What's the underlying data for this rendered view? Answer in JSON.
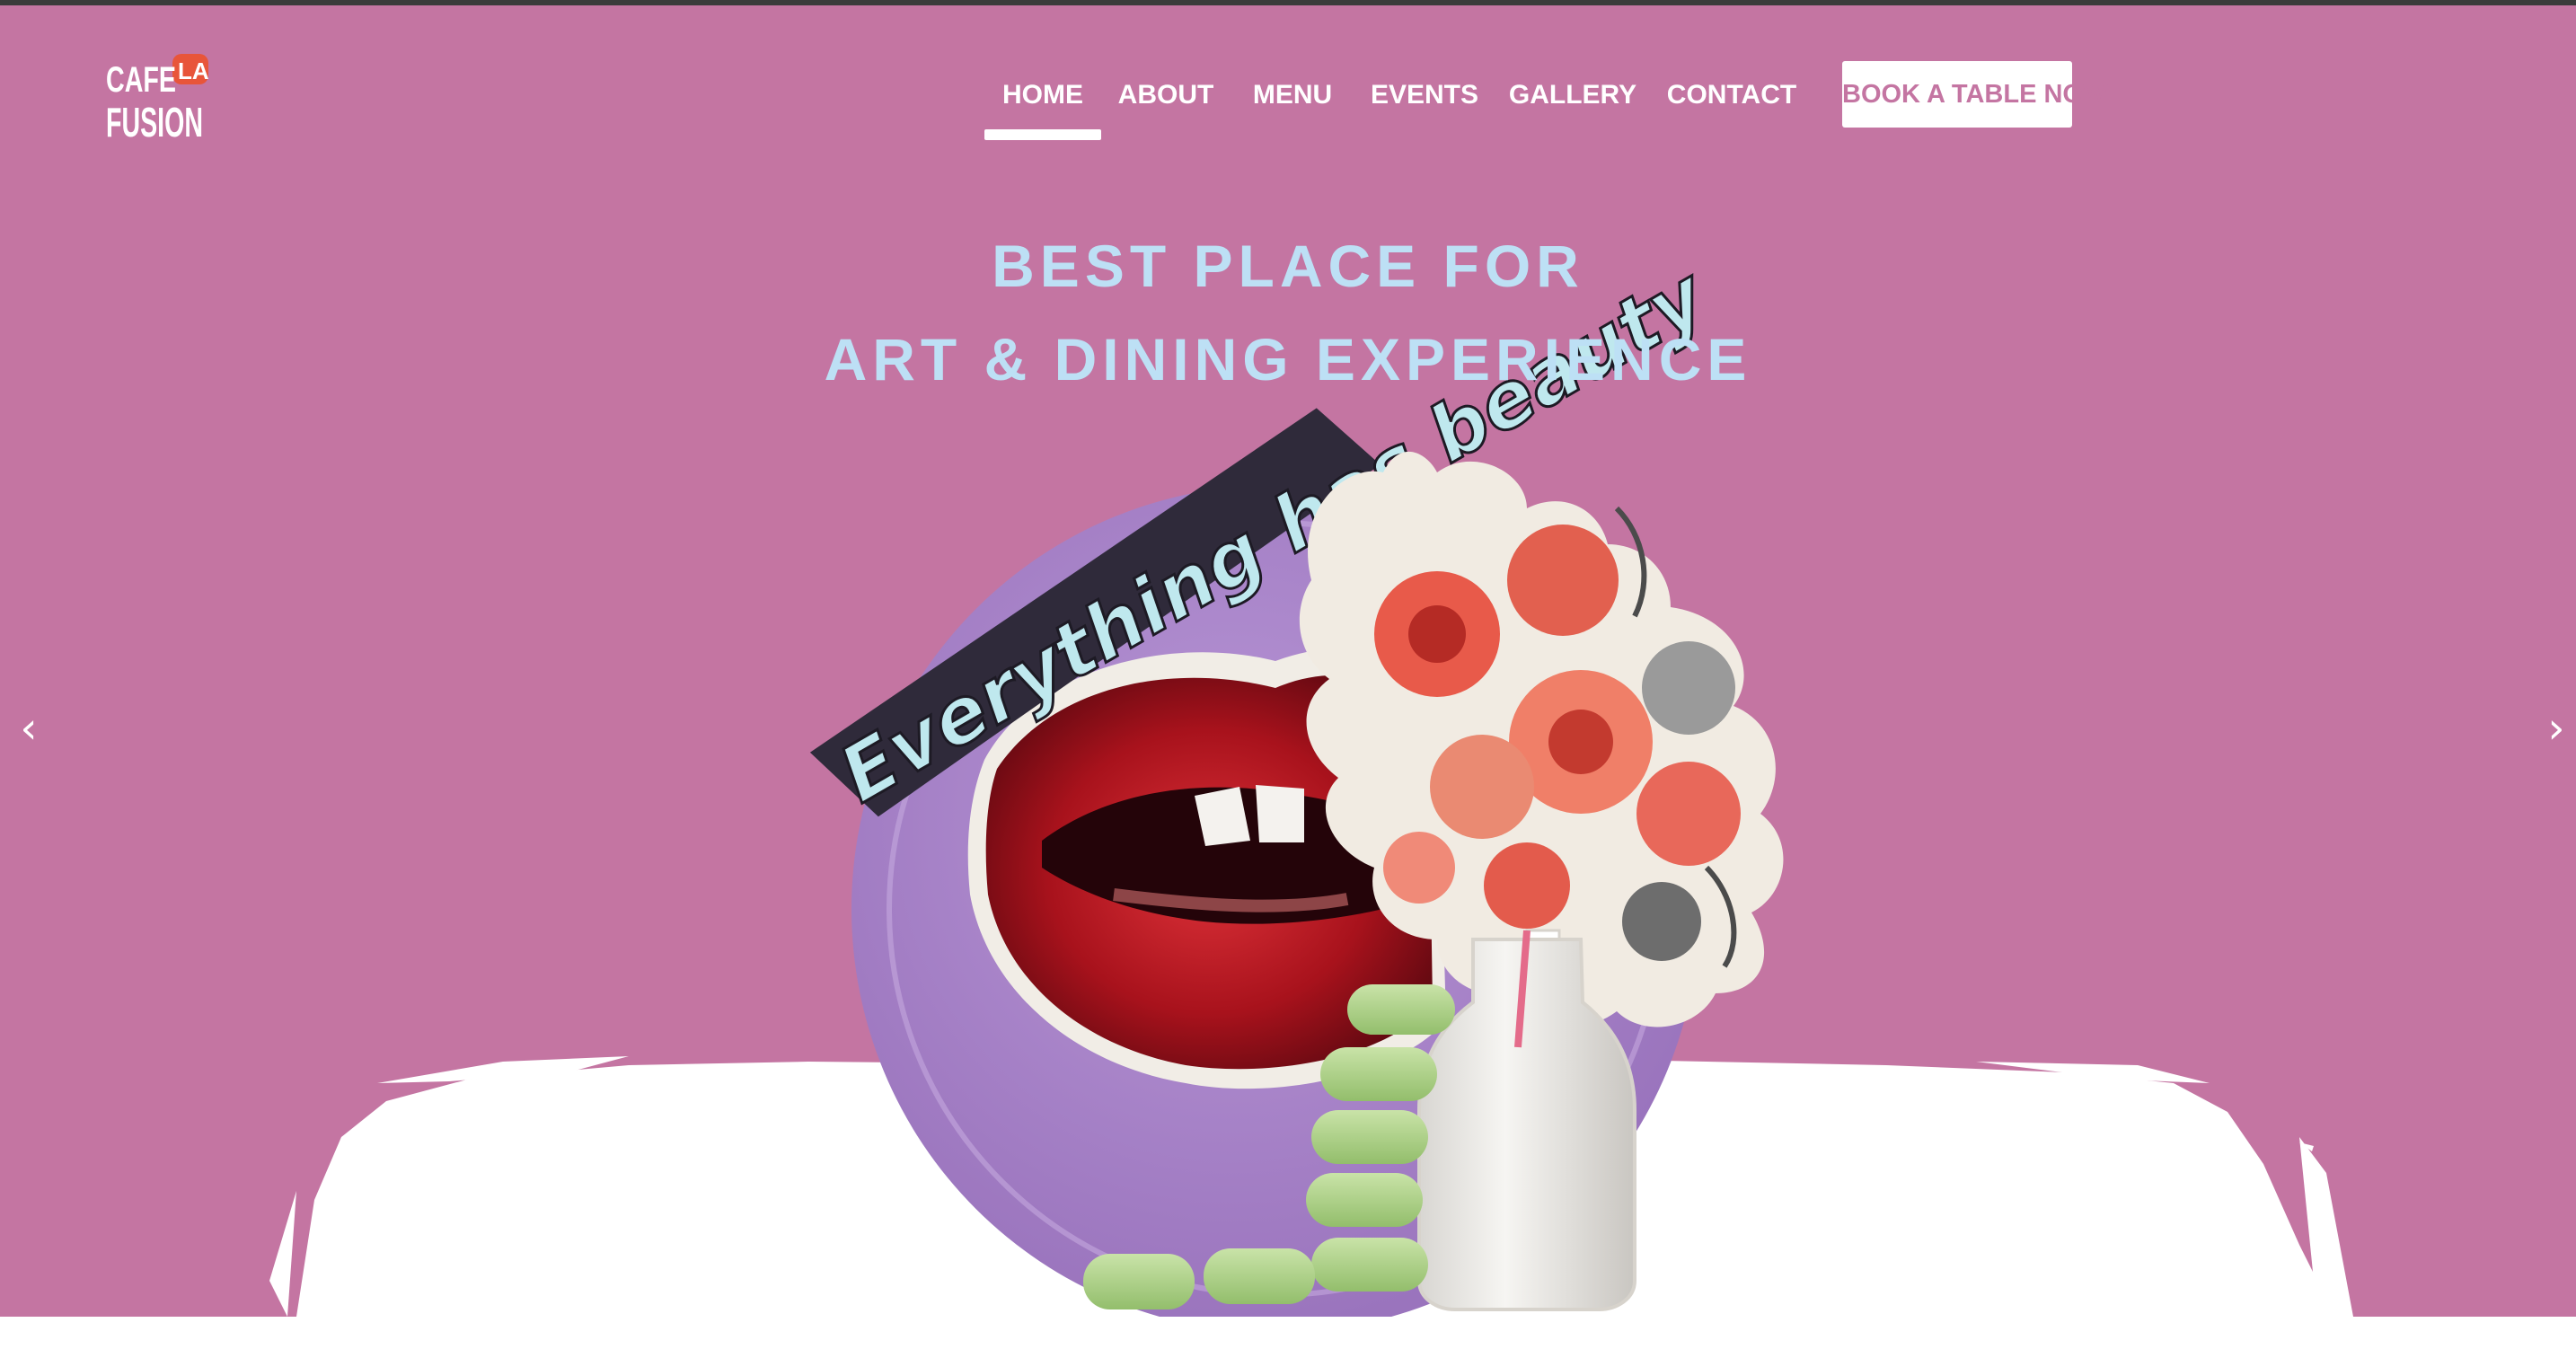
{
  "logo": {
    "line1": "CAFE",
    "badge": "LA",
    "line2": "FUSION"
  },
  "nav": {
    "items": [
      {
        "label": "HOME",
        "active": true
      },
      {
        "label": "ABOUT",
        "active": false
      },
      {
        "label": "MENU",
        "active": false
      },
      {
        "label": "EVENTS",
        "active": false
      },
      {
        "label": "GALLERY",
        "active": false
      },
      {
        "label": "CONTACT",
        "active": false
      }
    ],
    "cta": "BOOK A TABLE NOW"
  },
  "hero": {
    "headline_line1": "BEST PLACE FOR",
    "headline_line2": "ART & DINING EXPERIENCE",
    "artwork_text": "Everything has beauty",
    "prev_arrow": "‹",
    "next_arrow": "›"
  },
  "colors": {
    "hero_bg": "#c475a2",
    "headline": "#bde0f5",
    "plate": "#a683c4",
    "logo_badge": "#e8553a",
    "white": "#ffffff"
  }
}
